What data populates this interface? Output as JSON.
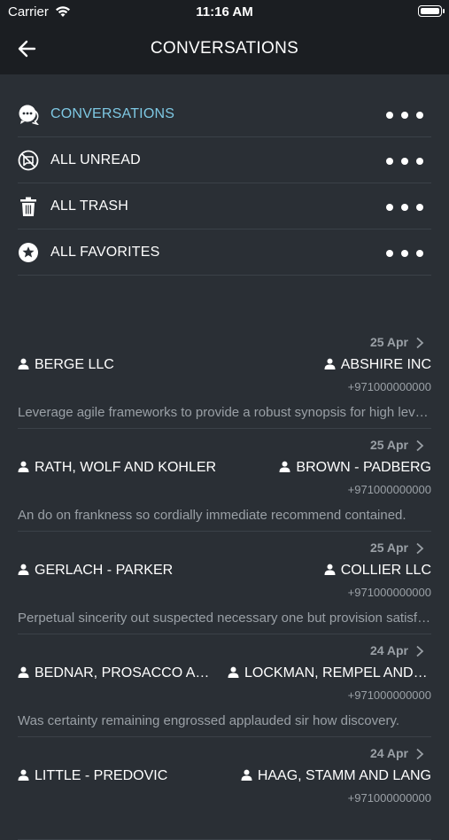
{
  "status_bar": {
    "carrier": "Carrier",
    "time": "11:16 AM"
  },
  "header": {
    "title": "CONVERSATIONS"
  },
  "menu": {
    "items": [
      {
        "label": "CONVERSATIONS",
        "icon": "chat-bubbles-icon",
        "active": true
      },
      {
        "label": "ALL UNREAD",
        "icon": "unread-off-icon"
      },
      {
        "label": "ALL TRASH",
        "icon": "trash-icon"
      },
      {
        "label": "ALL FAVORITES",
        "icon": "star-circle-icon"
      }
    ]
  },
  "conversations": [
    {
      "date": "25 Apr",
      "from": "BERGE LLC",
      "to": "ABSHIRE INC",
      "phone": "+971000000000",
      "preview": "Leverage agile frameworks to provide a robust synopsis for high level overviews."
    },
    {
      "date": "25 Apr",
      "from": "RATH, WOLF AND KOHLER",
      "to": "BROWN - PADBERG",
      "phone": "+971000000000",
      "preview": "An do on frankness so cordially immediate recommend contained."
    },
    {
      "date": "25 Apr",
      "from": "GERLACH - PARKER",
      "to": "COLLIER LLC",
      "phone": "+971000000000",
      "preview": "Perpetual sincerity out suspected necessary one but provision satisfied."
    },
    {
      "date": "24 Apr",
      "from": "BEDNAR, PROSACCO AND HANE",
      "to": "LOCKMAN, REMPEL AND DOYLE",
      "phone": "+971000000000",
      "preview": "Was certainty remaining engrossed applauded sir how discovery."
    },
    {
      "date": "24 Apr",
      "from": "LITTLE - PREDOVIC",
      "to": "HAAG, STAMM AND LANG",
      "phone": "+971000000000",
      "preview": ""
    }
  ],
  "colors": {
    "background": "#2a2f35",
    "bar": "#1b1e22",
    "accent": "#7ec8e3",
    "muted": "#9aa0a6",
    "divider": "#3b4148"
  }
}
